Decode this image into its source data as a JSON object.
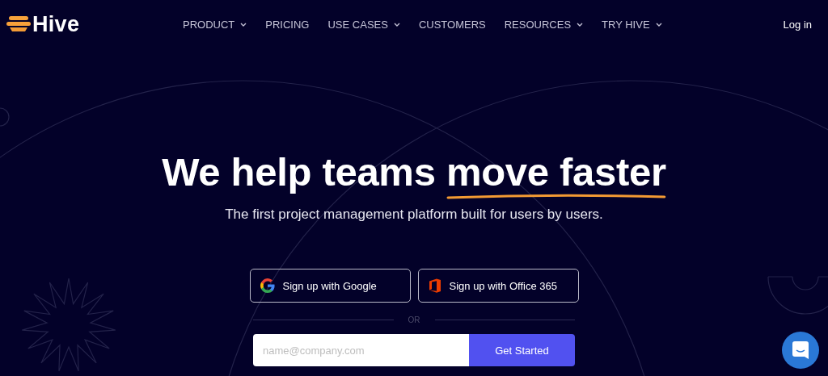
{
  "header": {
    "logo": "Hive",
    "nav": [
      {
        "label": "PRODUCT",
        "kind": "dropdown"
      },
      {
        "label": "PRICING",
        "kind": "link"
      },
      {
        "label": "USE CASES",
        "kind": "dropdown"
      },
      {
        "label": "CUSTOMERS",
        "kind": "link"
      },
      {
        "label": "RESOURCES",
        "kind": "dropdown"
      },
      {
        "label": "TRY HIVE",
        "kind": "dropdown"
      }
    ],
    "login": "Log in"
  },
  "hero": {
    "headline": "We help teams",
    "headline_highlight": "move faster",
    "subtitle": "The first project management platform built for users by users.",
    "sso_buttons": [
      {
        "label": "Sign up with Google",
        "kind": "google"
      },
      {
        "label": "Sign up with Office 365",
        "kind": "office"
      }
    ],
    "divider": "OR",
    "email": {
      "placeholder": "name@company.com"
    },
    "submit": "Get Started"
  }
}
